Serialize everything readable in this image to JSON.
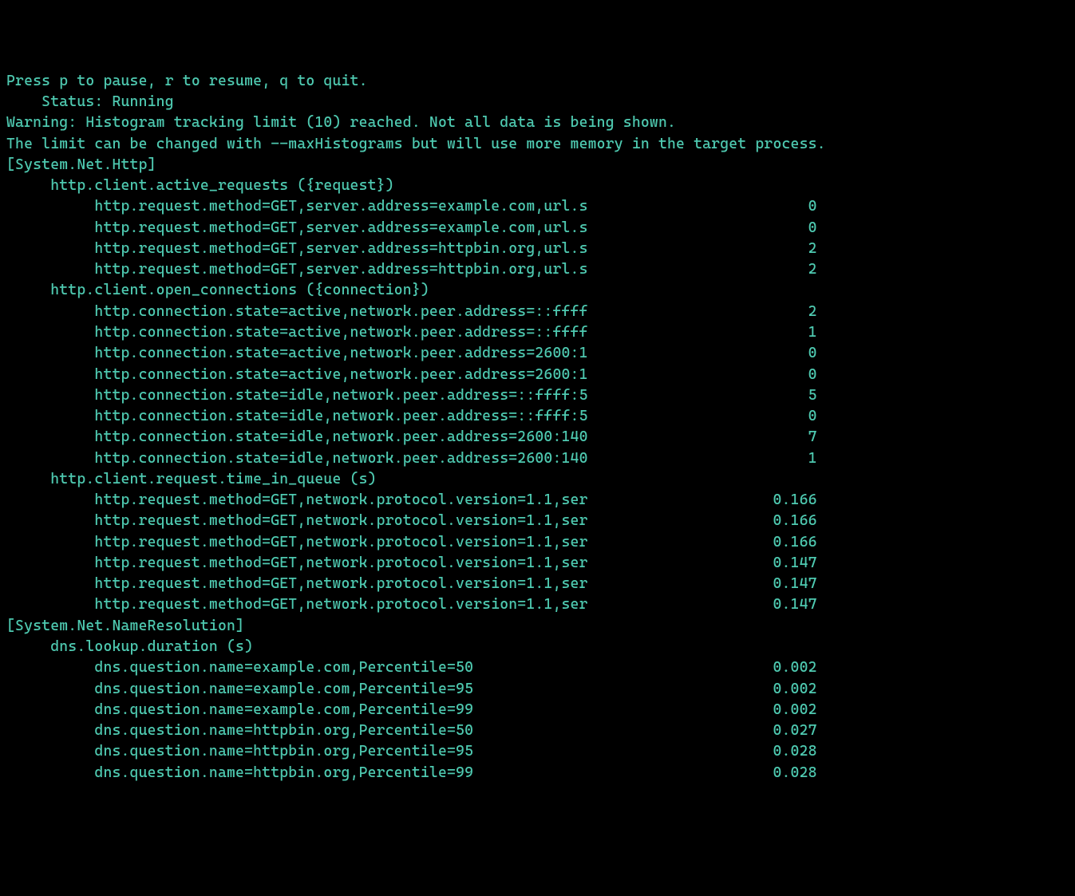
{
  "header": {
    "instructions": "Press p to pause, r to resume, q to quit.",
    "status_label": "    Status: ",
    "status_value": "Running",
    "warning_line1": "Warning: Histogram tracking limit (10) reached. Not all data is being shown.",
    "warning_line2": "The limit can be changed with --maxHistograms but will use more memory in the target process."
  },
  "sections": [
    {
      "title": "[System.Net.Http]",
      "metrics": [
        {
          "name": "http.client.active_requests ({request})",
          "rows": [
            {
              "label": "http.request.method=GET,server.address=example.com,url.s",
              "value": "0"
            },
            {
              "label": "http.request.method=GET,server.address=example.com,url.s",
              "value": "0"
            },
            {
              "label": "http.request.method=GET,server.address=httpbin.org,url.s",
              "value": "2"
            },
            {
              "label": "http.request.method=GET,server.address=httpbin.org,url.s",
              "value": "2"
            }
          ]
        },
        {
          "name": "http.client.open_connections ({connection})",
          "rows": [
            {
              "label": "http.connection.state=active,network.peer.address=::ffff",
              "value": "2"
            },
            {
              "label": "http.connection.state=active,network.peer.address=::ffff",
              "value": "1"
            },
            {
              "label": "http.connection.state=active,network.peer.address=2600:1",
              "value": "0"
            },
            {
              "label": "http.connection.state=active,network.peer.address=2600:1",
              "value": "0"
            },
            {
              "label": "http.connection.state=idle,network.peer.address=::ffff:5",
              "value": "5"
            },
            {
              "label": "http.connection.state=idle,network.peer.address=::ffff:5",
              "value": "0"
            },
            {
              "label": "http.connection.state=idle,network.peer.address=2600:140",
              "value": "7"
            },
            {
              "label": "http.connection.state=idle,network.peer.address=2600:140",
              "value": "1"
            }
          ]
        },
        {
          "name": "http.client.request.time_in_queue (s)",
          "rows": [
            {
              "label": "http.request.method=GET,network.protocol.version=1.1,ser",
              "value": "0.166"
            },
            {
              "label": "http.request.method=GET,network.protocol.version=1.1,ser",
              "value": "0.166"
            },
            {
              "label": "http.request.method=GET,network.protocol.version=1.1,ser",
              "value": "0.166"
            },
            {
              "label": "http.request.method=GET,network.protocol.version=1.1,ser",
              "value": "0.147"
            },
            {
              "label": "http.request.method=GET,network.protocol.version=1.1,ser",
              "value": "0.147"
            },
            {
              "label": "http.request.method=GET,network.protocol.version=1.1,ser",
              "value": "0.147"
            }
          ]
        }
      ]
    },
    {
      "title": "[System.Net.NameResolution]",
      "metrics": [
        {
          "name": "dns.lookup.duration (s)",
          "rows": [
            {
              "label": "dns.question.name=example.com,Percentile=50",
              "value": "0.002"
            },
            {
              "label": "dns.question.name=example.com,Percentile=95",
              "value": "0.002"
            },
            {
              "label": "dns.question.name=example.com,Percentile=99",
              "value": "0.002"
            },
            {
              "label": "dns.question.name=httpbin.org,Percentile=50",
              "value": "0.027"
            },
            {
              "label": "dns.question.name=httpbin.org,Percentile=95",
              "value": "0.028"
            },
            {
              "label": "dns.question.name=httpbin.org,Percentile=99",
              "value": "0.028"
            }
          ]
        }
      ]
    }
  ],
  "layout": {
    "label_width_ch": 67,
    "value_width_ch": 25
  }
}
